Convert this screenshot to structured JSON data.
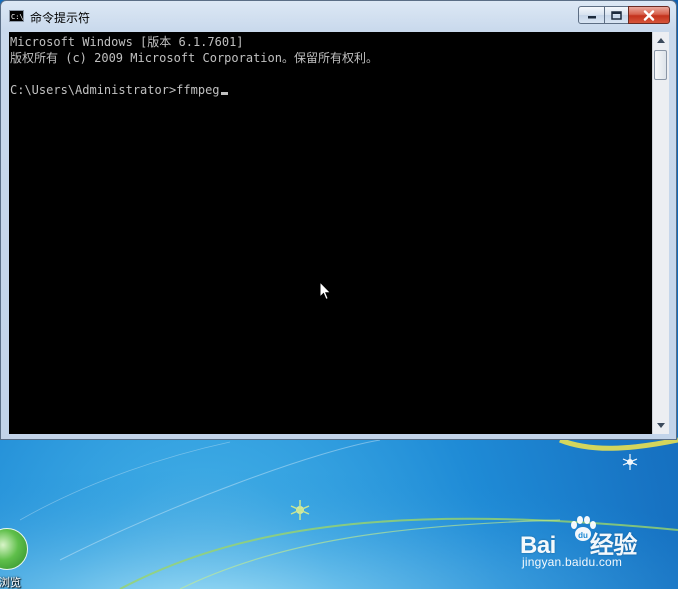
{
  "window": {
    "title": "命令提示符",
    "icon_glyph": "C:\\"
  },
  "console": {
    "lines": [
      "Microsoft Windows [版本 6.1.7601]",
      "版权所有 (c) 2009 Microsoft Corporation。保留所有权利。",
      "",
      "C:\\Users\\Administrator>ffmpeg"
    ]
  },
  "caption_buttons": {
    "minimize": "minimize-icon",
    "maximize": "maximize-icon",
    "close": "close-icon"
  },
  "desktop": {
    "icon_label": "浏览"
  },
  "watermark": {
    "brand": "Bai  经验",
    "brand_left": "Bai",
    "brand_right": "经验",
    "url": "jingyan.baidu.com"
  },
  "colors": {
    "console_bg": "#000000",
    "console_fg": "#c0c0c0",
    "close_button": "#c3321c",
    "desktop_bg": "#1f8bd6"
  }
}
